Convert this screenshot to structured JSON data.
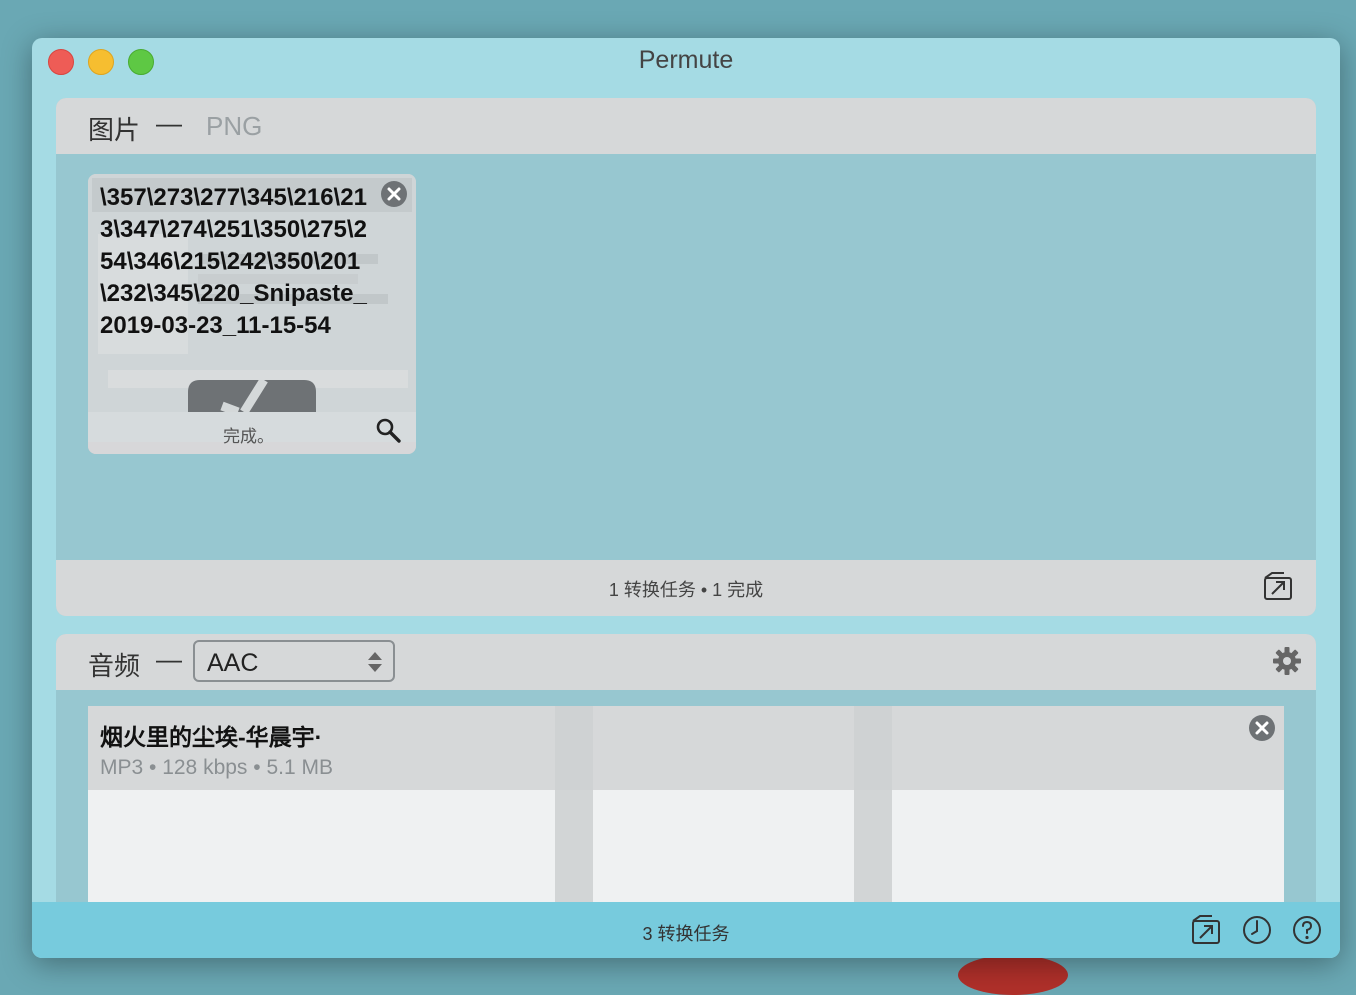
{
  "window": {
    "title": "Permute"
  },
  "image_section": {
    "category": "图片",
    "separator": "—",
    "format": "PNG",
    "task": {
      "file_name": "\\357\\273\\277\\345\\216\\213\\347\\274\\251\\350\\275\\254\\346\\215\\242\\350\\201\\232\\345\\220_Snipaste_2019-03-23_11-15-54",
      "status": "完成。"
    },
    "summary": "1 转换任务 • 1 完成"
  },
  "audio_section": {
    "category": "音频",
    "separator": "—",
    "format_selected": "AAC",
    "task": {
      "title": "烟火里的尘埃-华晨宇·",
      "meta": "MP3 • 128 kbps • 5.1 MB"
    }
  },
  "toolbar": {
    "tasks": "3 转换任务"
  },
  "icons": [
    "close-icon",
    "reveal-in-finder-icon",
    "open-output-folder-icon",
    "gear-icon",
    "history-clock-icon",
    "help-icon",
    "stepper-arrows-icon",
    "checkmark-icon"
  ]
}
